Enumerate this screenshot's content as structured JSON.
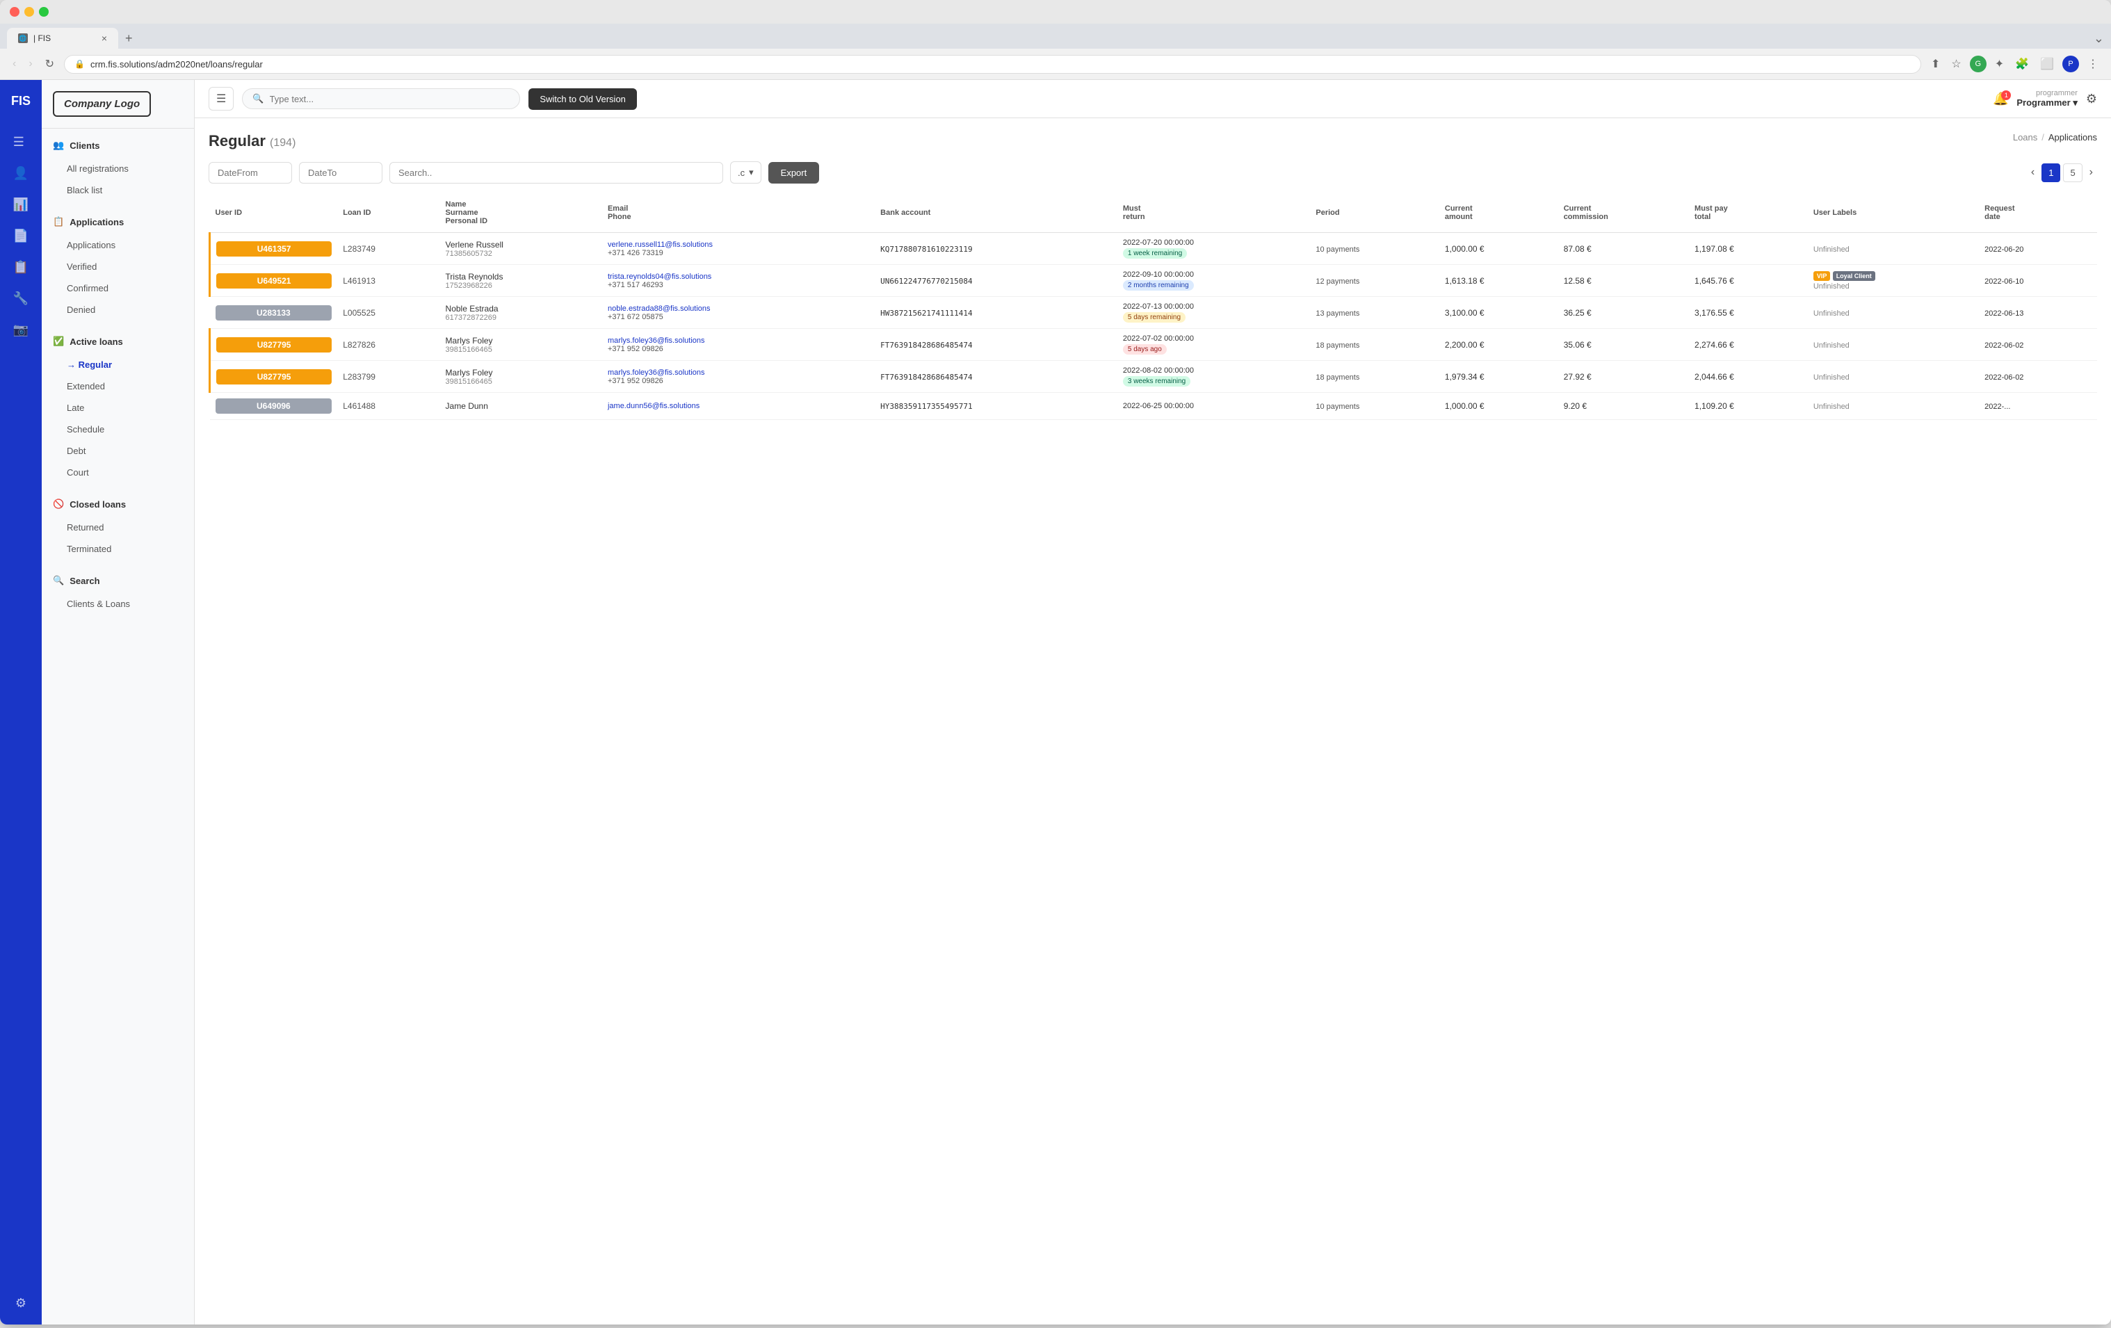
{
  "browser": {
    "tab_favicon": "FIS",
    "tab_title": "| FIS",
    "url": "crm.fis.solutions/adm2020net/loans/regular",
    "close_label": "×",
    "new_tab_label": "+",
    "nav_back": "‹",
    "nav_forward": "›",
    "nav_refresh": "↻"
  },
  "brand": {
    "short": "FIS"
  },
  "sidebar_logo": {
    "text_italic": "Company",
    "text_bold": " Logo"
  },
  "nav_icons": [
    {
      "name": "menu-icon",
      "glyph": "☰"
    },
    {
      "name": "list-icon",
      "glyph": "☰"
    },
    {
      "name": "person-icon",
      "glyph": "👤"
    },
    {
      "name": "chart-icon",
      "glyph": "📊"
    },
    {
      "name": "document-icon",
      "glyph": "📄"
    },
    {
      "name": "clipboard-icon",
      "glyph": "📋"
    },
    {
      "name": "wrench-icon",
      "glyph": "🔧"
    },
    {
      "name": "camera-icon",
      "glyph": "📷"
    },
    {
      "name": "settings-icon",
      "glyph": "⚙"
    }
  ],
  "sidebar": {
    "sections": [
      {
        "name": "clients",
        "icon": "👥",
        "label": "Clients",
        "items": [
          {
            "label": "All registrations",
            "active": false
          },
          {
            "label": "Black list",
            "active": false
          }
        ]
      },
      {
        "name": "applications",
        "icon": "📋",
        "label": "Applications",
        "items": [
          {
            "label": "Applications",
            "active": false
          },
          {
            "label": "Verified",
            "active": false
          },
          {
            "label": "Confirmed",
            "active": false
          },
          {
            "label": "Denied",
            "active": false
          }
        ]
      },
      {
        "name": "active-loans",
        "icon": "✅",
        "label": "Active loans",
        "items": [
          {
            "label": "Regular",
            "active": true
          },
          {
            "label": "Extended",
            "active": false
          },
          {
            "label": "Late",
            "active": false
          },
          {
            "label": "Schedule",
            "active": false
          },
          {
            "label": "Debt",
            "active": false
          },
          {
            "label": "Court",
            "active": false
          }
        ]
      },
      {
        "name": "closed-loans",
        "icon": "🚫",
        "label": "Closed loans",
        "items": [
          {
            "label": "Returned",
            "active": false
          },
          {
            "label": "Terminated",
            "active": false
          }
        ]
      },
      {
        "name": "search",
        "icon": "🔍",
        "label": "Search",
        "items": [
          {
            "label": "Clients & Loans",
            "active": false
          }
        ]
      }
    ]
  },
  "header": {
    "search_placeholder": "Type text...",
    "switch_button": "Switch to Old Version",
    "notif_count": "1",
    "user_role": "programmer",
    "user_name": "Programmer",
    "settings_icon": "⚙"
  },
  "page": {
    "title": "Regular",
    "count": "(194)",
    "breadcrumb": {
      "parent": "Loans",
      "separator": "/",
      "current": "Applications"
    }
  },
  "filters": {
    "date_from_placeholder": "DateFrom",
    "date_to_placeholder": "DateTo",
    "search_placeholder": "Search..",
    "select_value": ".c",
    "export_label": "Export"
  },
  "pagination": {
    "prev": "‹",
    "next": "›",
    "current": "1",
    "total": "5"
  },
  "table": {
    "columns": [
      "User ID",
      "Loan ID",
      "Name\nSurname\nPersonal ID",
      "Email\nPhone",
      "Bank account",
      "Must\nreturn",
      "Period",
      "Current\namount",
      "Current\ncommission",
      "Must pay\ntotal",
      "User Labels",
      "Request\ndate"
    ],
    "rows": [
      {
        "user_id": "U461357",
        "loan_id": "L283749",
        "name": "Verlene Russell",
        "pid": "71385605732",
        "email": "verlene.russell11@fis.solutions",
        "phone": "+371 426 73319",
        "bank_account": "KQ717880781610223119",
        "must_return": "2022-07-20 00:00:00",
        "remaining": "1 week remaining",
        "remaining_class": "green",
        "period": "10 payments",
        "current_amount": "1,000.00 €",
        "commission": "87.08 €",
        "must_pay": "1,197.08 €",
        "labels": "Unfinished",
        "request_date": "2022-06-20",
        "row_highlight": "orange"
      },
      {
        "user_id": "U649521",
        "loan_id": "L461913",
        "name": "Trista Reynolds",
        "pid": "17523968226",
        "email": "trista.reynolds04@fis.solutions",
        "phone": "+371 517 46293",
        "bank_account": "UN661224776770215084",
        "must_return": "2022-09-10 00:00:00",
        "remaining": "2 months remaining",
        "remaining_class": "blue",
        "period": "12 payments",
        "current_amount": "1,613.18 €",
        "commission": "12.58 €",
        "must_pay": "1,645.76 €",
        "labels_vip": "VIP",
        "labels_loyal": "Loyal Client",
        "labels": "Unfinished",
        "request_date": "2022-06-10",
        "row_highlight": "orange"
      },
      {
        "user_id": "U283133",
        "loan_id": "L005525",
        "name": "Noble Estrada",
        "pid": "617372872269",
        "email": "noble.estrada88@fis.solutions",
        "phone": "+371 672 05875",
        "bank_account": "HW387215621741111414",
        "must_return": "2022-07-13 00:00:00",
        "remaining": "5 days remaining",
        "remaining_class": "orange",
        "period": "13 payments",
        "current_amount": "3,100.00 €",
        "commission": "36.25 €",
        "must_pay": "3,176.55 €",
        "labels": "Unfinished",
        "request_date": "2022-06-13",
        "row_highlight": "none"
      },
      {
        "user_id": "U827795",
        "loan_id": "L827826",
        "name": "Marlys Foley",
        "pid": "39815166465",
        "email": "marlys.foley36@fis.solutions",
        "phone": "+371 952 09826",
        "bank_account": "FT763918428686485474",
        "must_return": "2022-07-02 00:00:00",
        "remaining": "5 days ago",
        "remaining_class": "red",
        "period": "18 payments",
        "current_amount": "2,200.00 €",
        "commission": "35.06 €",
        "must_pay": "2,274.66 €",
        "labels": "Unfinished",
        "request_date": "2022-06-02",
        "row_highlight": "orange"
      },
      {
        "user_id": "U827795",
        "loan_id": "L283799",
        "name": "Marlys Foley",
        "pid": "39815166465",
        "email": "marlys.foley36@fis.solutions",
        "phone": "+371 952 09826",
        "bank_account": "FT763918428686485474",
        "must_return": "2022-08-02 00:00:00",
        "remaining": "3 weeks remaining",
        "remaining_class": "green",
        "period": "18 payments",
        "current_amount": "1,979.34 €",
        "commission": "27.92 €",
        "must_pay": "2,044.66 €",
        "labels": "Unfinished",
        "request_date": "2022-06-02",
        "row_highlight": "orange"
      },
      {
        "user_id": "U649096",
        "loan_id": "L461488",
        "name": "Jame Dunn",
        "pid": "",
        "email": "jame.dunn56@fis.solutions",
        "phone": "",
        "bank_account": "HY388359117355495771",
        "must_return": "2022-06-25 00:00:00",
        "remaining": "",
        "remaining_class": "none",
        "period": "10 payments",
        "current_amount": "1,000.00 €",
        "commission": "9.20 €",
        "must_pay": "1,109.20 €",
        "labels": "Unfinished",
        "request_date": "2022-...",
        "row_highlight": "none"
      }
    ]
  }
}
